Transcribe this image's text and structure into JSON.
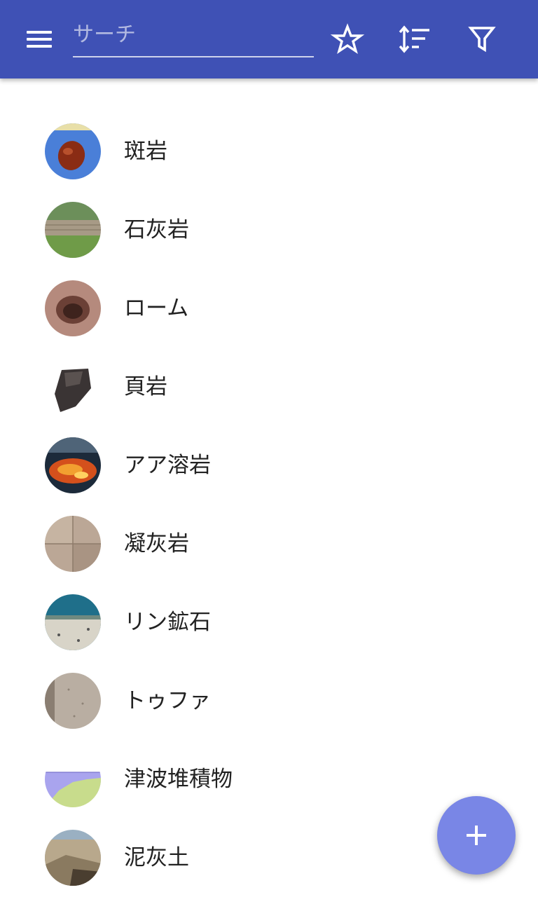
{
  "appbar": {
    "color": "#3f51b5",
    "menu_icon": "hamburger-menu-icon",
    "search": {
      "placeholder": "サーチ",
      "value": ""
    },
    "actions": [
      {
        "icon": "star-outline-icon"
      },
      {
        "icon": "sort-icon"
      },
      {
        "icon": "filter-icon"
      }
    ]
  },
  "rocks": [
    {
      "label": "斑岩"
    },
    {
      "label": "石灰岩"
    },
    {
      "label": "ローム"
    },
    {
      "label": "頁岩"
    },
    {
      "label": "アア溶岩"
    },
    {
      "label": "凝灰岩"
    },
    {
      "label": "リン鉱石"
    },
    {
      "label": "トゥファ"
    },
    {
      "label": "津波堆積物"
    },
    {
      "label": "泥灰土"
    }
  ],
  "fab": {
    "icon": "plus-icon",
    "color": "#7986e6"
  }
}
